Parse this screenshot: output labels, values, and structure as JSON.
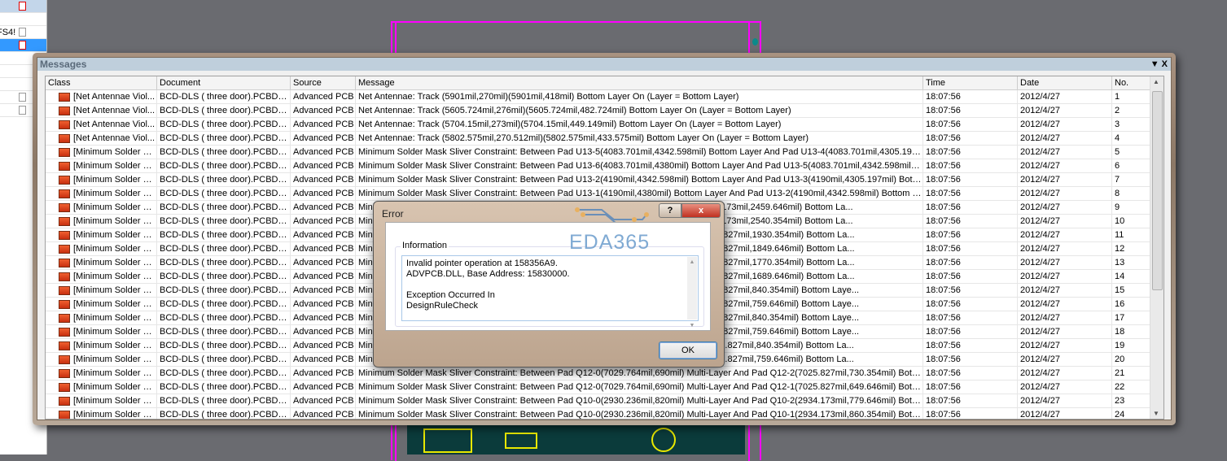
{
  "left_panel": {
    "partial_text": "FS4!"
  },
  "messages_panel": {
    "title": "Messages",
    "menu_glyph": "▼",
    "close_glyph": "X",
    "columns": [
      "Class",
      "Document",
      "Source",
      "Message",
      "Time",
      "Date",
      "No."
    ],
    "rows": [
      {
        "class": "[Net Antennae Viol...",
        "document": "BCD-DLS  ( three door).PCBDOC",
        "source": "Advanced PCB",
        "message": "Net Antennae: Track (5901mil,270mil)(5901mil,418mil)  Bottom Layer On (Layer = Bottom Layer)",
        "time": "18:07:56",
        "date": "2012/4/27",
        "no": "1"
      },
      {
        "class": "[Net Antennae Viol...",
        "document": "BCD-DLS  ( three door).PCBDOC",
        "source": "Advanced PCB",
        "message": "Net Antennae: Track (5605.724mil,276mil)(5605.724mil,482.724mil)  Bottom Layer On (Layer = Bottom Layer)",
        "time": "18:07:56",
        "date": "2012/4/27",
        "no": "2"
      },
      {
        "class": "[Net Antennae Viol...",
        "document": "BCD-DLS  ( three door).PCBDOC",
        "source": "Advanced PCB",
        "message": "Net Antennae: Track (5704.15mil,273mil)(5704.15mil,449.149mil)  Bottom Layer On (Layer = Bottom Layer)",
        "time": "18:07:56",
        "date": "2012/4/27",
        "no": "3"
      },
      {
        "class": "[Net Antennae Viol...",
        "document": "BCD-DLS  ( three door).PCBDOC",
        "source": "Advanced PCB",
        "message": "Net Antennae: Track (5802.575mil,270.512mil)(5802.575mil,433.575mil)  Bottom Layer On (Layer = Bottom Layer)",
        "time": "18:07:56",
        "date": "2012/4/27",
        "no": "4"
      },
      {
        "class": "[Minimum Solder M...",
        "document": "BCD-DLS  ( three door).PCBDOC",
        "source": "Advanced PCB",
        "message": "Minimum Solder Mask Sliver Constraint: Between Pad U13-5(4083.701mil,4342.598mil)  Bottom Layer And Pad U13-4(4083.701mil,4305.197mil)  ...",
        "time": "18:07:56",
        "date": "2012/4/27",
        "no": "5"
      },
      {
        "class": "[Minimum Solder M...",
        "document": "BCD-DLS  ( three door).PCBDOC",
        "source": "Advanced PCB",
        "message": "Minimum Solder Mask Sliver Constraint: Between Pad U13-6(4083.701mil,4380mil)  Bottom Layer And Pad U13-5(4083.701mil,4342.598mil)  Botto...",
        "time": "18:07:56",
        "date": "2012/4/27",
        "no": "6"
      },
      {
        "class": "[Minimum Solder M...",
        "document": "BCD-DLS  ( three door).PCBDOC",
        "source": "Advanced PCB",
        "message": "Minimum Solder Mask Sliver Constraint: Between Pad U13-2(4190mil,4342.598mil)  Bottom Layer And Pad U13-3(4190mil,4305.197mil)  Bottom L...",
        "time": "18:07:56",
        "date": "2012/4/27",
        "no": "7"
      },
      {
        "class": "[Minimum Solder M...",
        "document": "BCD-DLS  ( three door).PCBDOC",
        "source": "Advanced PCB",
        "message": "Minimum Solder Mask Sliver Constraint: Between Pad U13-1(4190mil,4380mil)  Bottom Layer And Pad U13-2(4190mil,4342.598mil)  Bottom Layer ...",
        "time": "18:07:56",
        "date": "2012/4/27",
        "no": "8"
      },
      {
        "class": "[Minimum Solder M...",
        "document": "BCD-DLS  ( three door).PCBDOC",
        "source": "Advanced PCB",
        "message": "Minimum Solder Mask Sliver Constraint: Between Pad ...  Bottom Layer And Pad T1-2(3374.173mil,2459.646mil)  Bottom La...",
        "time": "18:07:56",
        "date": "2012/4/27",
        "no": "9"
      },
      {
        "class": "[Minimum Solder M...",
        "document": "BCD-DLS  ( three door).PCBDOC",
        "source": "Advanced PCB",
        "message": "Minimum Solder Mask Sliver Constraint: Between Pad ...  Bottom Layer And Pad T1-1(3374.173mil,2540.354mil)  Bottom La...",
        "time": "18:07:56",
        "date": "2012/4/27",
        "no": "10"
      },
      {
        "class": "[Minimum Solder M...",
        "document": "BCD-DLS  ( three door).PCBDOC",
        "source": "Advanced PCB",
        "message": "Minimum Solder Mask Sliver Constraint: Between Pad ...  Bottom Layer And Pad Q2-2(5595.827mil,1930.354mil)  Bottom La...",
        "time": "18:07:56",
        "date": "2012/4/27",
        "no": "11"
      },
      {
        "class": "[Minimum Solder M...",
        "document": "BCD-DLS  ( three door).PCBDOC",
        "source": "Advanced PCB",
        "message": "Minimum Solder Mask Sliver Constraint: Between Pad ...  Bottom Layer And Pad Q2-1(5595.827mil,1849.646mil)  Bottom La...",
        "time": "18:07:56",
        "date": "2012/4/27",
        "no": "12"
      },
      {
        "class": "[Minimum Solder M...",
        "document": "BCD-DLS  ( three door).PCBDOC",
        "source": "Advanced PCB",
        "message": "Minimum Solder Mask Sliver Constraint: Between Pad ...  Bottom Layer And Pad Q4-2(5595.827mil,1770.354mil)  Bottom La...",
        "time": "18:07:56",
        "date": "2012/4/27",
        "no": "13"
      },
      {
        "class": "[Minimum Solder M...",
        "document": "BCD-DLS  ( three door).PCBDOC",
        "source": "Advanced PCB",
        "message": "Minimum Solder Mask Sliver Constraint: Between Pad ...  Bottom Layer And Pad Q4-1(5595.827mil,1689.646mil)  Bottom La...",
        "time": "18:07:56",
        "date": "2012/4/27",
        "no": "14"
      },
      {
        "class": "[Minimum Solder M...",
        "document": "BCD-DLS  ( three door).PCBDOC",
        "source": "Advanced PCB",
        "message": "Minimum Solder Mask Sliver Constraint: Between Pad ...  Bottom Layer And Pad Q8-2(4985.827mil,840.354mil)  Bottom Laye...",
        "time": "18:07:56",
        "date": "2012/4/27",
        "no": "15"
      },
      {
        "class": "[Minimum Solder M...",
        "document": "BCD-DLS  ( three door).PCBDOC",
        "source": "Advanced PCB",
        "message": "Minimum Solder Mask Sliver Constraint: Between Pad ...  Bottom Layer And Pad Q8-1(4985.827mil,759.646mil)  Bottom Laye...",
        "time": "18:07:56",
        "date": "2012/4/27",
        "no": "16"
      },
      {
        "class": "[Minimum Solder M...",
        "document": "BCD-DLS  ( three door).PCBDOC",
        "source": "Advanced PCB",
        "message": "Minimum Solder Mask Sliver Constraint: Between Pad ...  Bottom Layer And Pad Q7-2(5255.827mil,840.354mil)  Bottom Laye...",
        "time": "18:07:56",
        "date": "2012/4/27",
        "no": "17"
      },
      {
        "class": "[Minimum Solder M...",
        "document": "BCD-DLS  ( three door).PCBDOC",
        "source": "Advanced PCB",
        "message": "Minimum Solder Mask Sliver Constraint: Between Pad ...  Bottom Layer And Pad Q7-1(5255.827mil,759.646mil)  Bottom Laye...",
        "time": "18:07:56",
        "date": "2012/4/27",
        "no": "18"
      },
      {
        "class": "[Minimum Solder M...",
        "document": "BCD-DLS  ( three door).PCBDOC",
        "source": "Advanced PCB",
        "message": "Minimum Solder Mask Sliver Constraint: Between Pad ...  Bottom Layer And Pad Q11-2(6575.827mil,840.354mil)  Bottom La...",
        "time": "18:07:56",
        "date": "2012/4/27",
        "no": "19"
      },
      {
        "class": "[Minimum Solder M...",
        "document": "BCD-DLS  ( three door).PCBDOC",
        "source": "Advanced PCB",
        "message": "Minimum Solder Mask Sliver Constraint: Between Pad ...  Bottom Layer And Pad Q11-1(6575.827mil,759.646mil)  Bottom La...",
        "time": "18:07:56",
        "date": "2012/4/27",
        "no": "20"
      },
      {
        "class": "[Minimum Solder M...",
        "document": "BCD-DLS  ( three door).PCBDOC",
        "source": "Advanced PCB",
        "message": "Minimum Solder Mask Sliver Constraint: Between Pad Q12-0(7029.764mil,690mil)  Multi-Layer And Pad Q12-2(7025.827mil,730.354mil)  Bottom La...",
        "time": "18:07:56",
        "date": "2012/4/27",
        "no": "21"
      },
      {
        "class": "[Minimum Solder M...",
        "document": "BCD-DLS  ( three door).PCBDOC",
        "source": "Advanced PCB",
        "message": "Minimum Solder Mask Sliver Constraint: Between Pad Q12-0(7029.764mil,690mil)  Multi-Layer And Pad Q12-1(7025.827mil,649.646mil)  Bottom La...",
        "time": "18:07:56",
        "date": "2012/4/27",
        "no": "22"
      },
      {
        "class": "[Minimum Solder M...",
        "document": "BCD-DLS  ( three door).PCBDOC",
        "source": "Advanced PCB",
        "message": "Minimum Solder Mask Sliver Constraint: Between Pad Q10-0(2930.236mil,820mil)  Multi-Layer And Pad Q10-2(2934.173mil,779.646mil)  Bottom La...",
        "time": "18:07:56",
        "date": "2012/4/27",
        "no": "23"
      },
      {
        "class": "[Minimum Solder M...",
        "document": "BCD-DLS  ( three door).PCBDOC",
        "source": "Advanced PCB",
        "message": "Minimum Solder Mask Sliver Constraint: Between Pad Q10-0(2930.236mil,820mil)  Multi-Layer And Pad Q10-1(2934.173mil,860.354mil)  Bottom La...",
        "time": "18:07:56",
        "date": "2012/4/27",
        "no": "24"
      }
    ]
  },
  "error_dialog": {
    "title": "Error",
    "help_glyph": "?",
    "close_glyph": "x",
    "group_label": "Information",
    "text": "Invalid pointer operation at 158356A9.\nADVPCB.DLL, Base Address: 15830000.\n\nException Occurred In\nDesignRuleCheck",
    "ok_label": "OK",
    "watermark": "EDA365"
  }
}
